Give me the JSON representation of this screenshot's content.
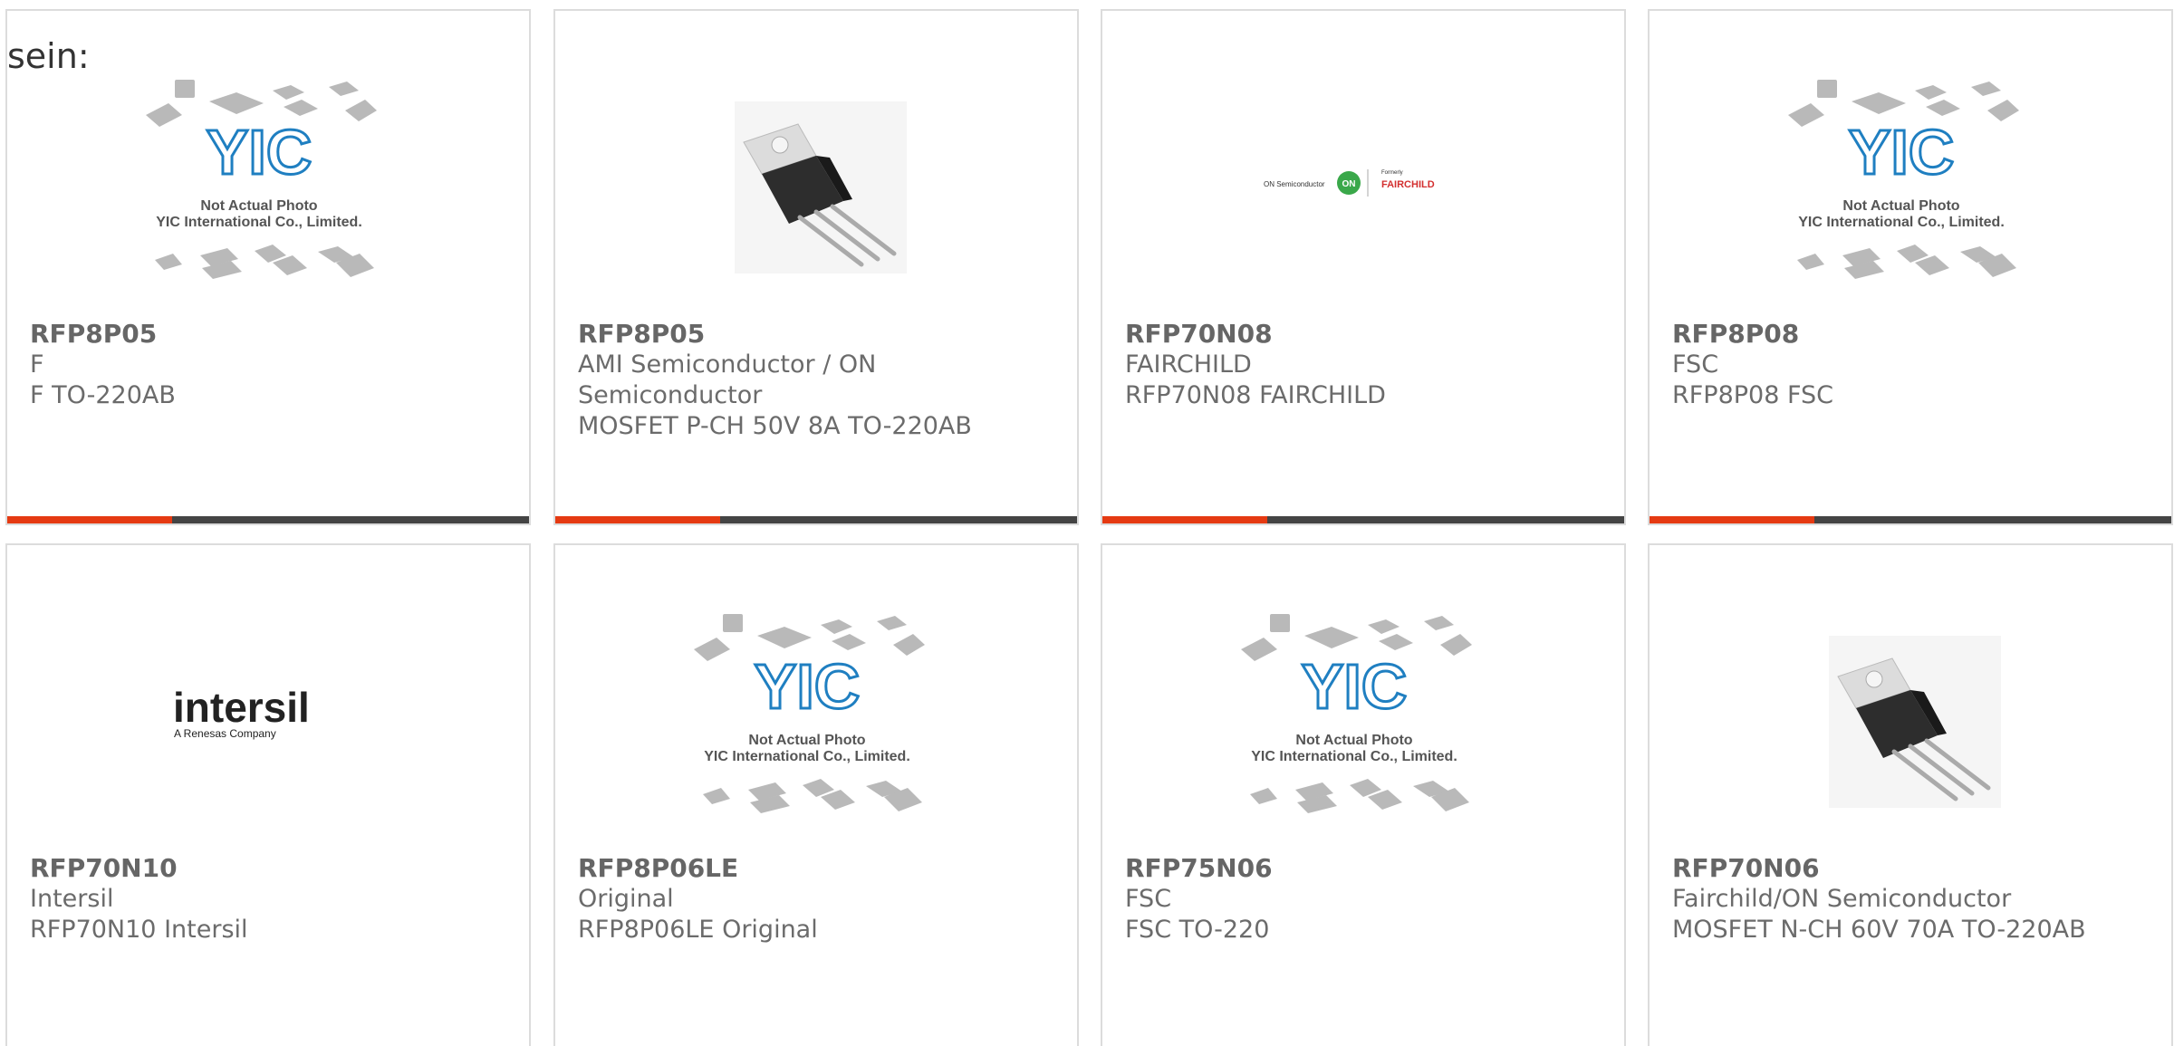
{
  "heading_fragment": "sein:",
  "colors": {
    "accent": "#e53a12",
    "bar": "#444444",
    "text": "#6b6b6b",
    "yic_blue": "#1f7fc1"
  },
  "placeholder": {
    "brand": "YIC",
    "line1": "Not Actual Photo",
    "line2": "YIC International Co., Limited."
  },
  "logos": {
    "onsemi_left": "ON Semiconductor",
    "onsemi_on": "ON",
    "onsemi_formerly": "Formerly",
    "fairchild": "FAIRCHILD",
    "intersil": "intersil",
    "intersil_sub": "A Renesas Company"
  },
  "products": [
    {
      "part": "RFP8P05",
      "brand": "F",
      "desc": "F TO-220AB",
      "image": "placeholder"
    },
    {
      "part": "RFP8P05",
      "brand": "AMI Semiconductor / ON Semiconductor",
      "desc": "MOSFET P-CH 50V 8A TO-220AB",
      "image": "to220"
    },
    {
      "part": "RFP70N08",
      "brand": "FAIRCHILD",
      "desc": "RFP70N08 FAIRCHILD",
      "image": "onsemi-fairchild-logo"
    },
    {
      "part": "RFP8P08",
      "brand": "FSC",
      "desc": "RFP8P08 FSC",
      "image": "placeholder"
    },
    {
      "part": "RFP70N10",
      "brand": "Intersil",
      "desc": "RFP70N10 Intersil",
      "image": "intersil-logo"
    },
    {
      "part": "RFP8P06LE",
      "brand": "Original",
      "desc": "RFP8P06LE Original",
      "image": "placeholder"
    },
    {
      "part": "RFP75N06",
      "brand": "FSC",
      "desc": "FSC TO-220",
      "image": "placeholder"
    },
    {
      "part": "RFP70N06",
      "brand": "Fairchild/ON Semiconductor",
      "desc": "MOSFET N-CH 60V 70A TO-220AB",
      "image": "to220"
    }
  ]
}
